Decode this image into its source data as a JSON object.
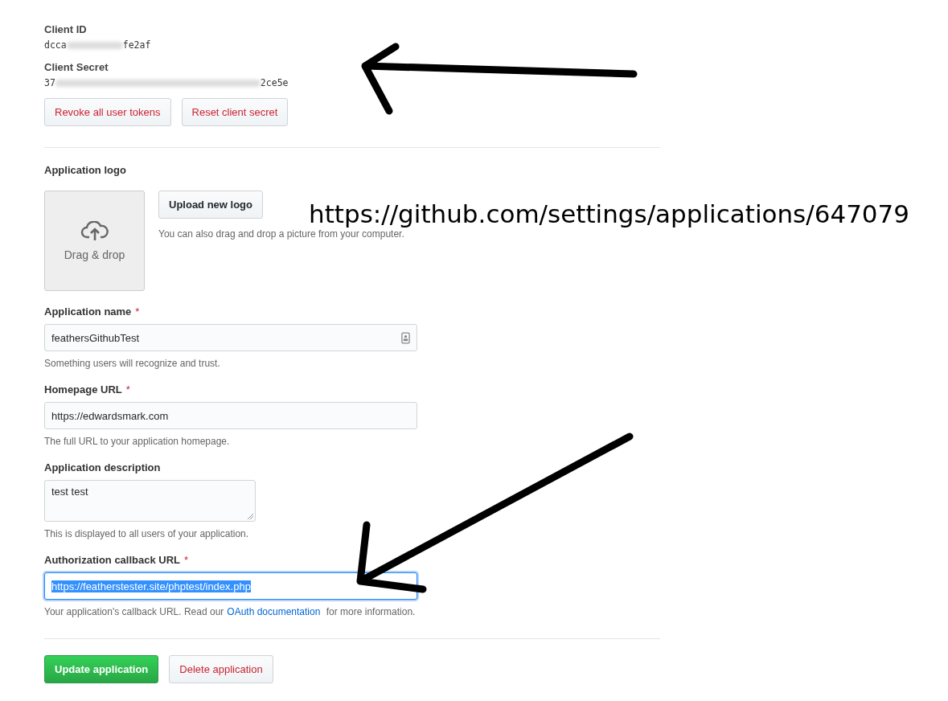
{
  "credentials": [
    {
      "label": "Client ID",
      "value_start": "dcca",
      "value_end": "fe2af"
    },
    {
      "label": "Client Secret",
      "value_start": "37",
      "value_end": "2ce5e"
    }
  ],
  "credential_buttons": [
    "Revoke all user tokens",
    "Reset client secret"
  ],
  "logo": {
    "label": "Application logo",
    "drop_text": "Drag & drop",
    "upload_button": "Upload new logo",
    "hint": "You can also drag and drop a picture from your computer."
  },
  "annotation_url": "https://github.com/settings/applications/647079",
  "fields": [
    {
      "kind": "input",
      "label": "Application name",
      "required_mark": "*",
      "value": "feathersGithubTest",
      "focused": false,
      "hint": "Something users will recognize and trust."
    },
    {
      "kind": "input",
      "label": "Homepage URL",
      "required_mark": "*",
      "value": "https://edwardsmark.com",
      "focused": false,
      "hint": "The full URL to your application homepage."
    },
    {
      "kind": "textarea",
      "label": "Application description",
      "value": "test test",
      "focused": false,
      "hint": "This is displayed to all users of your application."
    },
    {
      "kind": "input",
      "label": "Authorization callback URL",
      "required_mark": "*",
      "value": "https://featherstester.site/phptest/index.php",
      "focused": true,
      "hint": "Your application's callback URL. Read our",
      "hint_link": "OAuth documentation",
      "hint_after": "for more information."
    }
  ],
  "actions": [
    {
      "label": "Update application",
      "kind": "primary"
    },
    {
      "label": "Delete application",
      "kind": "danger"
    }
  ]
}
